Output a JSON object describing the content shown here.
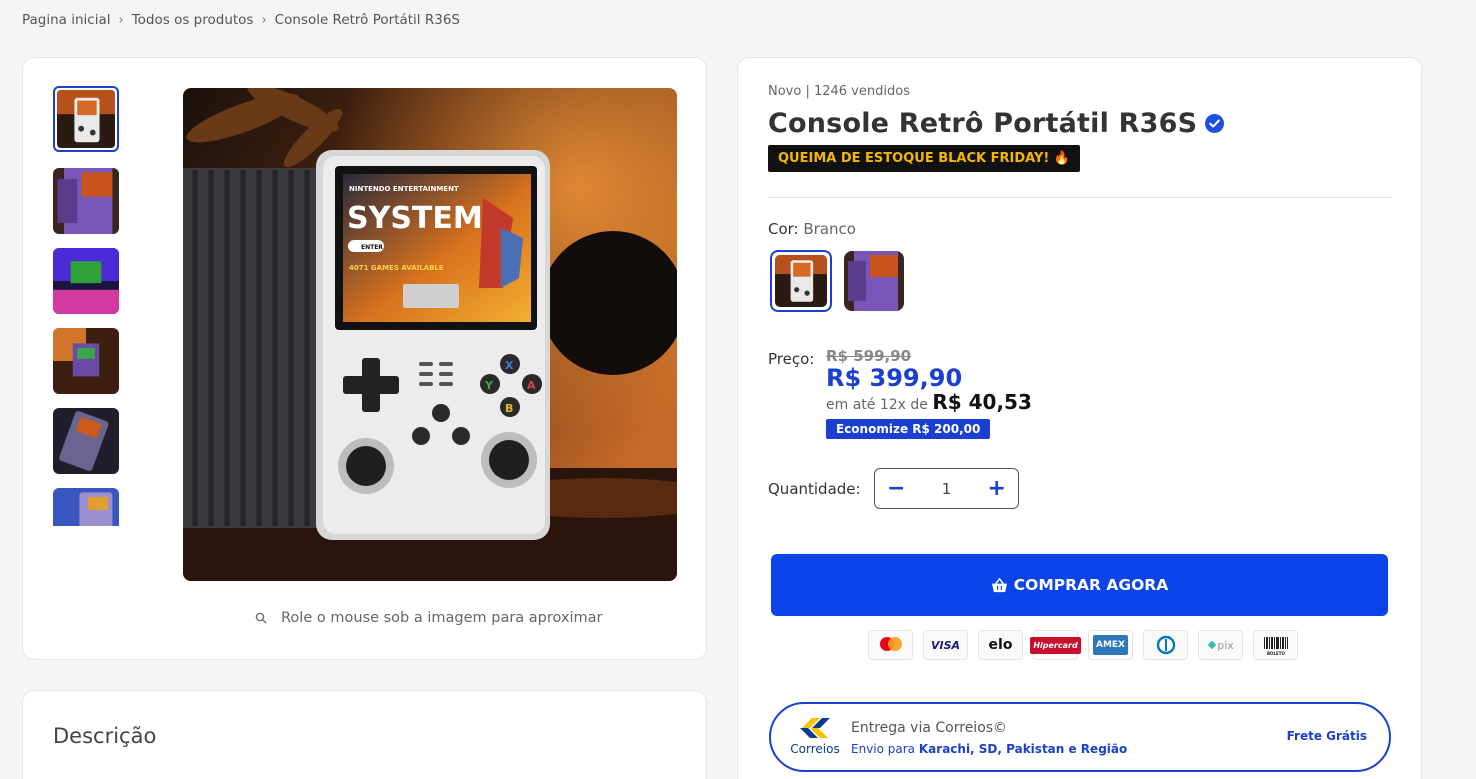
{
  "breadcrumb": {
    "items": [
      "Pagina inicial",
      "Todos os produtos",
      "Console Retrô Portátil R36S"
    ],
    "separator": "›"
  },
  "gallery": {
    "hint": "Role o mouse sob a imagem para aproximar",
    "thumbnail_count": 6,
    "active_thumbnail": 0
  },
  "description": {
    "title": "Descrição"
  },
  "product": {
    "meta": "Novo | 1246 vendidos",
    "title": "Console Retrô Portátil R36S",
    "verified_icon": "verified-check-icon",
    "promo": "QUEIMA DE ESTOQUE BLACK FRIDAY! 🔥",
    "screen_text": {
      "headline": "NINTENDO ENTERTAINMENT",
      "big": "SYSTEM",
      "enter": "ENTER",
      "games": "4071 GAMES AVAILABLE"
    }
  },
  "color": {
    "label": "Cor:",
    "value": "Branco",
    "options": [
      "Branco",
      "Roxo"
    ],
    "selected": 0
  },
  "price": {
    "label": "Preço:",
    "old": "R$ 599,90",
    "new": "R$ 399,90",
    "installment_prefix": "em até 12x de",
    "installment_value": "R$ 40,53",
    "savings": "Economize R$ 200,00"
  },
  "quantity": {
    "label": "Quantidade:",
    "minus": "−",
    "value": "1",
    "plus": "+"
  },
  "buy_button": {
    "label": "COMPRAR AGORA",
    "icon": "basket-icon"
  },
  "payments": [
    "mastercard",
    "VISA",
    "elo",
    "Hipercard",
    "AMEX",
    "Diners",
    "pix",
    "BOLETO"
  ],
  "shipping": {
    "logo_text": "Correios",
    "title": "Entrega via Correios©",
    "dest_prefix": "Envio para",
    "dest": "Karachi, SD, Pakistan e Região",
    "free": "Frete Grátis"
  },
  "colors": {
    "accent": "#0b45ea",
    "promo_bg": "#111111",
    "promo_fg": "#f5b800",
    "page_bg": "#f4f5f7"
  }
}
